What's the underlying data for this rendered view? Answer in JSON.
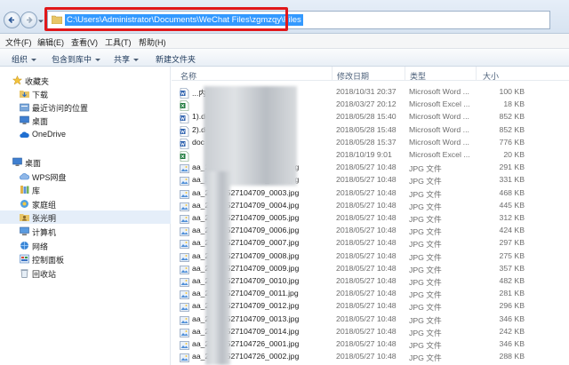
{
  "address": {
    "path": "C:\\Users\\Administrator\\Documents\\WeChat Files\\zgmzqy\\Files"
  },
  "menu": [
    "文件(F)",
    "编辑(E)",
    "查看(V)",
    "工具(T)",
    "帮助(H)"
  ],
  "toolbar": {
    "organize": "组织",
    "include": "包含到库中",
    "share": "共享",
    "new_folder": "新建文件夹"
  },
  "sidebar": {
    "favorites": "收藏夹",
    "downloads": "下载",
    "recent": "最近访问的位置",
    "desktop_fav": "桌面",
    "onedrive": "OneDrive",
    "desktop": "桌面",
    "wps": "WPS网盘",
    "library": "库",
    "homegroup": "家庭组",
    "user": "张光明",
    "computer": "计算机",
    "network": "网络",
    "control_panel": "控制面板",
    "recycle": "回收站"
  },
  "columns": {
    "name": "名称",
    "date": "修改日期",
    "type": "类型",
    "size": "大小"
  },
  "files": [
    {
      "icon": "word-icon",
      "name": "...内通知(...",
      "date": "2018/10/31 20:37",
      "type": "Microsoft Word ...",
      "size": "100 KB"
    },
    {
      "icon": "excel-icon",
      "name": "",
      "date": "2018/03/27 20:12",
      "type": "Microsoft Excel ...",
      "size": "18 KB"
    },
    {
      "icon": "word-icon",
      "name": "1).doc",
      "date": "2018/05/28 15:40",
      "type": "Microsoft Word ...",
      "size": "852 KB"
    },
    {
      "icon": "word-icon",
      "name": "2).doc",
      "date": "2018/05/28 15:48",
      "type": "Microsoft Word ...",
      "size": "852 KB"
    },
    {
      "icon": "word-icon",
      "name": "doc",
      "date": "2018/05/28 15:37",
      "type": "Microsoft Word ...",
      "size": "776 KB"
    },
    {
      "icon": "excel-icon",
      "name": "",
      "date": "2018/10/19 9:01",
      "type": "Microsoft Excel ...",
      "size": "20 KB"
    },
    {
      "icon": "jpg-icon",
      "name": "aa_20180527104709_0001.jpg",
      "date": "2018/05/27 10:48",
      "type": "JPG 文件",
      "size": "291 KB"
    },
    {
      "icon": "jpg-icon",
      "name": "aa_20180527104709_0002.jpg",
      "date": "2018/05/27 10:48",
      "type": "JPG 文件",
      "size": "331 KB"
    },
    {
      "icon": "jpg-icon",
      "name": "aa_20180527104709_0003.jpg",
      "date": "2018/05/27 10:48",
      "type": "JPG 文件",
      "size": "468 KB"
    },
    {
      "icon": "jpg-icon",
      "name": "aa_20180527104709_0004.jpg",
      "date": "2018/05/27 10:48",
      "type": "JPG 文件",
      "size": "445 KB"
    },
    {
      "icon": "jpg-icon",
      "name": "aa_20180527104709_0005.jpg",
      "date": "2018/05/27 10:48",
      "type": "JPG 文件",
      "size": "312 KB"
    },
    {
      "icon": "jpg-icon",
      "name": "aa_20180527104709_0006.jpg",
      "date": "2018/05/27 10:48",
      "type": "JPG 文件",
      "size": "424 KB"
    },
    {
      "icon": "jpg-icon",
      "name": "aa_20180527104709_0007.jpg",
      "date": "2018/05/27 10:48",
      "type": "JPG 文件",
      "size": "297 KB"
    },
    {
      "icon": "jpg-icon",
      "name": "aa_20180527104709_0008.jpg",
      "date": "2018/05/27 10:48",
      "type": "JPG 文件",
      "size": "275 KB"
    },
    {
      "icon": "jpg-icon",
      "name": "aa_20180527104709_0009.jpg",
      "date": "2018/05/27 10:48",
      "type": "JPG 文件",
      "size": "357 KB"
    },
    {
      "icon": "jpg-icon",
      "name": "aa_20180527104709_0010.jpg",
      "date": "2018/05/27 10:48",
      "type": "JPG 文件",
      "size": "482 KB"
    },
    {
      "icon": "jpg-icon",
      "name": "aa_20180527104709_0011.jpg",
      "date": "2018/05/27 10:48",
      "type": "JPG 文件",
      "size": "281 KB"
    },
    {
      "icon": "jpg-icon",
      "name": "aa_20180527104709_0012.jpg",
      "date": "2018/05/27 10:48",
      "type": "JPG 文件",
      "size": "296 KB"
    },
    {
      "icon": "jpg-icon",
      "name": "aa_20180527104709_0013.jpg",
      "date": "2018/05/27 10:48",
      "type": "JPG 文件",
      "size": "346 KB"
    },
    {
      "icon": "jpg-icon",
      "name": "aa_20180527104709_0014.jpg",
      "date": "2018/05/27 10:48",
      "type": "JPG 文件",
      "size": "242 KB"
    },
    {
      "icon": "jpg-icon",
      "name": "aa_20180527104726_0001.jpg",
      "date": "2018/05/27 10:48",
      "type": "JPG 文件",
      "size": "346 KB"
    },
    {
      "icon": "jpg-icon",
      "name": "aa_20180527104726_0002.jpg",
      "date": "2018/05/27 10:48",
      "type": "JPG 文件",
      "size": "288 KB"
    }
  ]
}
